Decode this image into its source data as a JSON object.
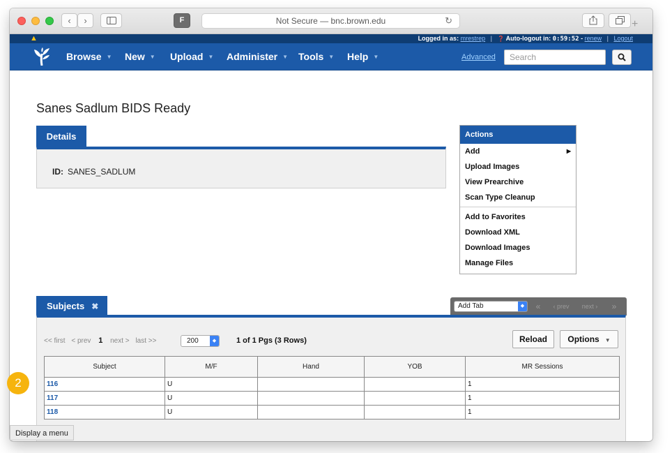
{
  "browser": {
    "address": "Not Secure — bnc.brown.edu",
    "back_glyph": "‹",
    "forward_glyph": "›",
    "favicon_letter": "F",
    "reload_glyph": "↻",
    "new_tab_glyph": "+"
  },
  "status": {
    "warning_glyph": "▲",
    "logged_in_label": "Logged in as:",
    "user": "mrestrep",
    "autologout_label": "Auto-logout in:",
    "timer": "0:59:52",
    "renew": "renew",
    "logout": "Logout",
    "separator": "|",
    "dash": "-",
    "info_glyph": "❓"
  },
  "nav": {
    "items": [
      "Browse",
      "New",
      "Upload",
      "Administer",
      "Tools",
      "Help"
    ],
    "caret": "▼",
    "advanced": "Advanced",
    "search_placeholder": "Search"
  },
  "page": {
    "title": "Sanes Sadlum BIDS Ready"
  },
  "details": {
    "tab": "Details",
    "id_label": "ID:",
    "id_value": "SANES_SADLUM"
  },
  "actions": {
    "header": "Actions",
    "add": "Add",
    "add_arrow": "▶",
    "upload_images": "Upload Images",
    "view_prearchive": "View Prearchive",
    "scan_type_cleanup": "Scan Type Cleanup",
    "add_to_favorites": "Add to Favorites",
    "download_xml": "Download XML",
    "download_images": "Download Images",
    "manage_files": "Manage Files"
  },
  "subjects": {
    "tab": "Subjects",
    "close_glyph": "✖",
    "add_tab": "Add Tab",
    "stepper_glyph": "◆",
    "pager_first": "«",
    "pager_prev": "‹ prev",
    "pager_next": "next ›",
    "pager_last": "»",
    "first": "<< first",
    "prev": "< prev",
    "current_page": "1",
    "next": "next >",
    "last": "last >>",
    "page_size": "200",
    "page_info": "1 of 1 Pgs (3 Rows)",
    "reload": "Reload",
    "options": "Options",
    "columns": [
      "Subject",
      "M/F",
      "Hand",
      "YOB",
      "MR Sessions"
    ],
    "rows": [
      {
        "subject": "116",
        "mf": "U",
        "hand": "",
        "yob": "",
        "mr_sessions": "1"
      },
      {
        "subject": "117",
        "mf": "U",
        "hand": "",
        "yob": "",
        "mr_sessions": "1"
      },
      {
        "subject": "118",
        "mf": "U",
        "hand": "",
        "yob": "",
        "mr_sessions": "1"
      }
    ]
  },
  "overlay": {
    "badge": "2",
    "tooltip": "Display a menu"
  },
  "colors": {
    "nav_blue": "#1c5aa8",
    "strip_blue": "#0f3d73",
    "badge": "#f6b40e"
  }
}
